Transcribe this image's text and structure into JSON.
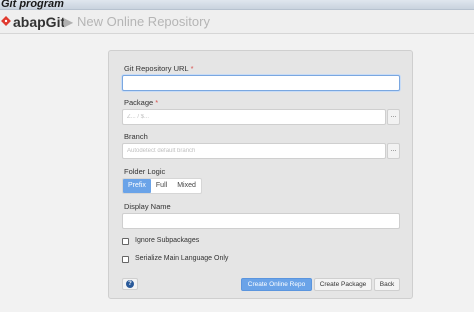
{
  "window": {
    "title": "Git program"
  },
  "header": {
    "brand": "abapGit",
    "separator": "▶",
    "page_title": "New Online Repository",
    "logo_color": "#e03a2f"
  },
  "form": {
    "url": {
      "label": "Git Repository URL",
      "required_mark": "*",
      "value": "",
      "placeholder": ""
    },
    "package": {
      "label": "Package",
      "required_mark": "*",
      "placeholder": "Z... / $...",
      "browse_label": "..."
    },
    "branch": {
      "label": "Branch",
      "placeholder": "Autodetect default branch",
      "browse_label": "..."
    },
    "folder_logic": {
      "label": "Folder Logic",
      "options": [
        "Prefix",
        "Full",
        "Mixed"
      ],
      "selected": "Prefix"
    },
    "display_name": {
      "label": "Display Name",
      "value": ""
    },
    "ignore_subpackages": {
      "label": "Ignore Subpackages",
      "checked": false
    },
    "serialize_main_lang": {
      "label": "Serialize Main Language Only",
      "checked": false
    }
  },
  "actions": {
    "help": "?",
    "create_online_repo": "Create Online Repo",
    "create_package": "Create Package",
    "back": "Back"
  },
  "colors": {
    "accent": "#6aa3e8",
    "required": "#d9534f"
  }
}
